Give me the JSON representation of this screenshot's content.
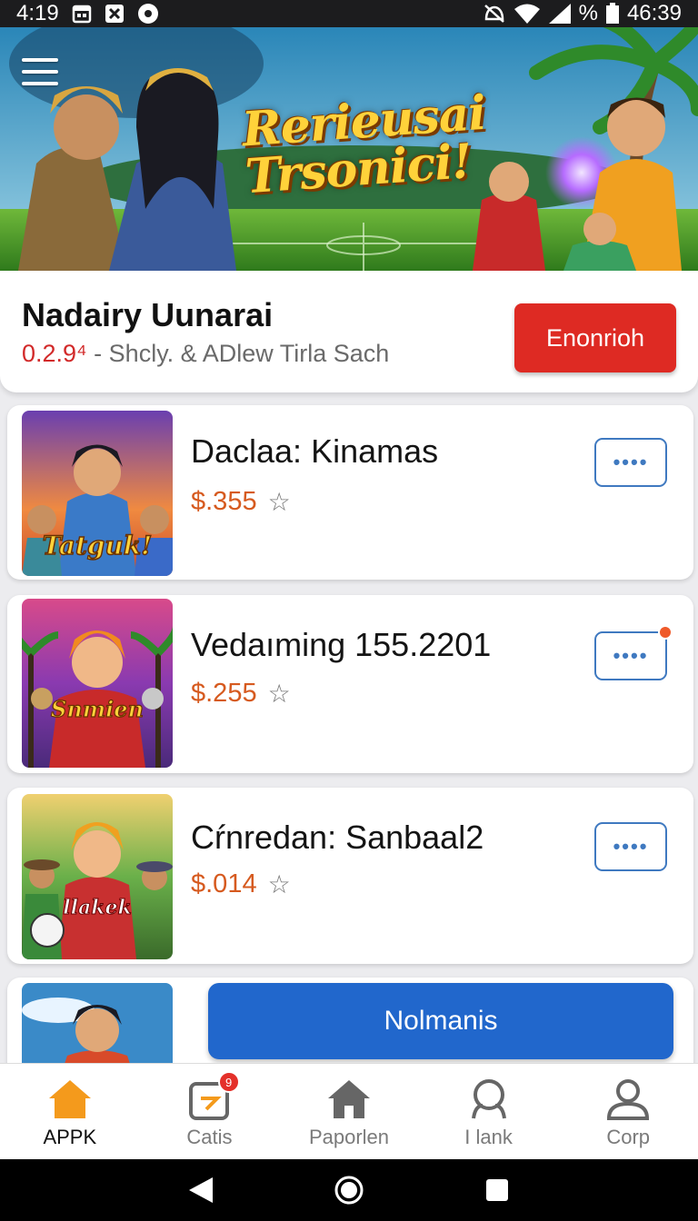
{
  "status_bar": {
    "time": "4:19",
    "battery_text": "%",
    "clock_right": "46:39"
  },
  "hero": {
    "title_line1": "Rerieusai",
    "title_line2": "Trsonici!",
    "colors": {
      "sky": "#3aa0c8",
      "grass": "#4f9a2c",
      "title": "#ffd23a"
    }
  },
  "app": {
    "name": "Nadairy Uunarai",
    "version": "0.2.9⁴",
    "meta": "- Shcly. & ADlew Tirla Sach",
    "primary_button": "Enonrioh",
    "accent": "#de2a23"
  },
  "items": [
    {
      "title": "Daclaa: Kinamas",
      "price": "$.355",
      "thumb_text": "Tatguk!",
      "more": "••••",
      "has_badge": false
    },
    {
      "title": "Vedaıming 155.2201",
      "price": "$.255",
      "thumb_text": "Snmien",
      "more": "••••",
      "has_badge": true
    },
    {
      "title": "Cŕnredan:  Sanbaal2",
      "price": "$.014",
      "thumb_text": "llakek",
      "more": "••••",
      "has_badge": false
    }
  ],
  "floating_button": "Nolmanis",
  "bottom_nav": [
    {
      "label": "APPK",
      "icon": "home-icon",
      "active": true
    },
    {
      "label": "Catis",
      "icon": "calendar-icon",
      "badge": "9"
    },
    {
      "label": "Paporlen",
      "icon": "house-icon"
    },
    {
      "label": "I lank",
      "icon": "search-icon"
    },
    {
      "label": "Corp",
      "icon": "profile-icon"
    }
  ]
}
